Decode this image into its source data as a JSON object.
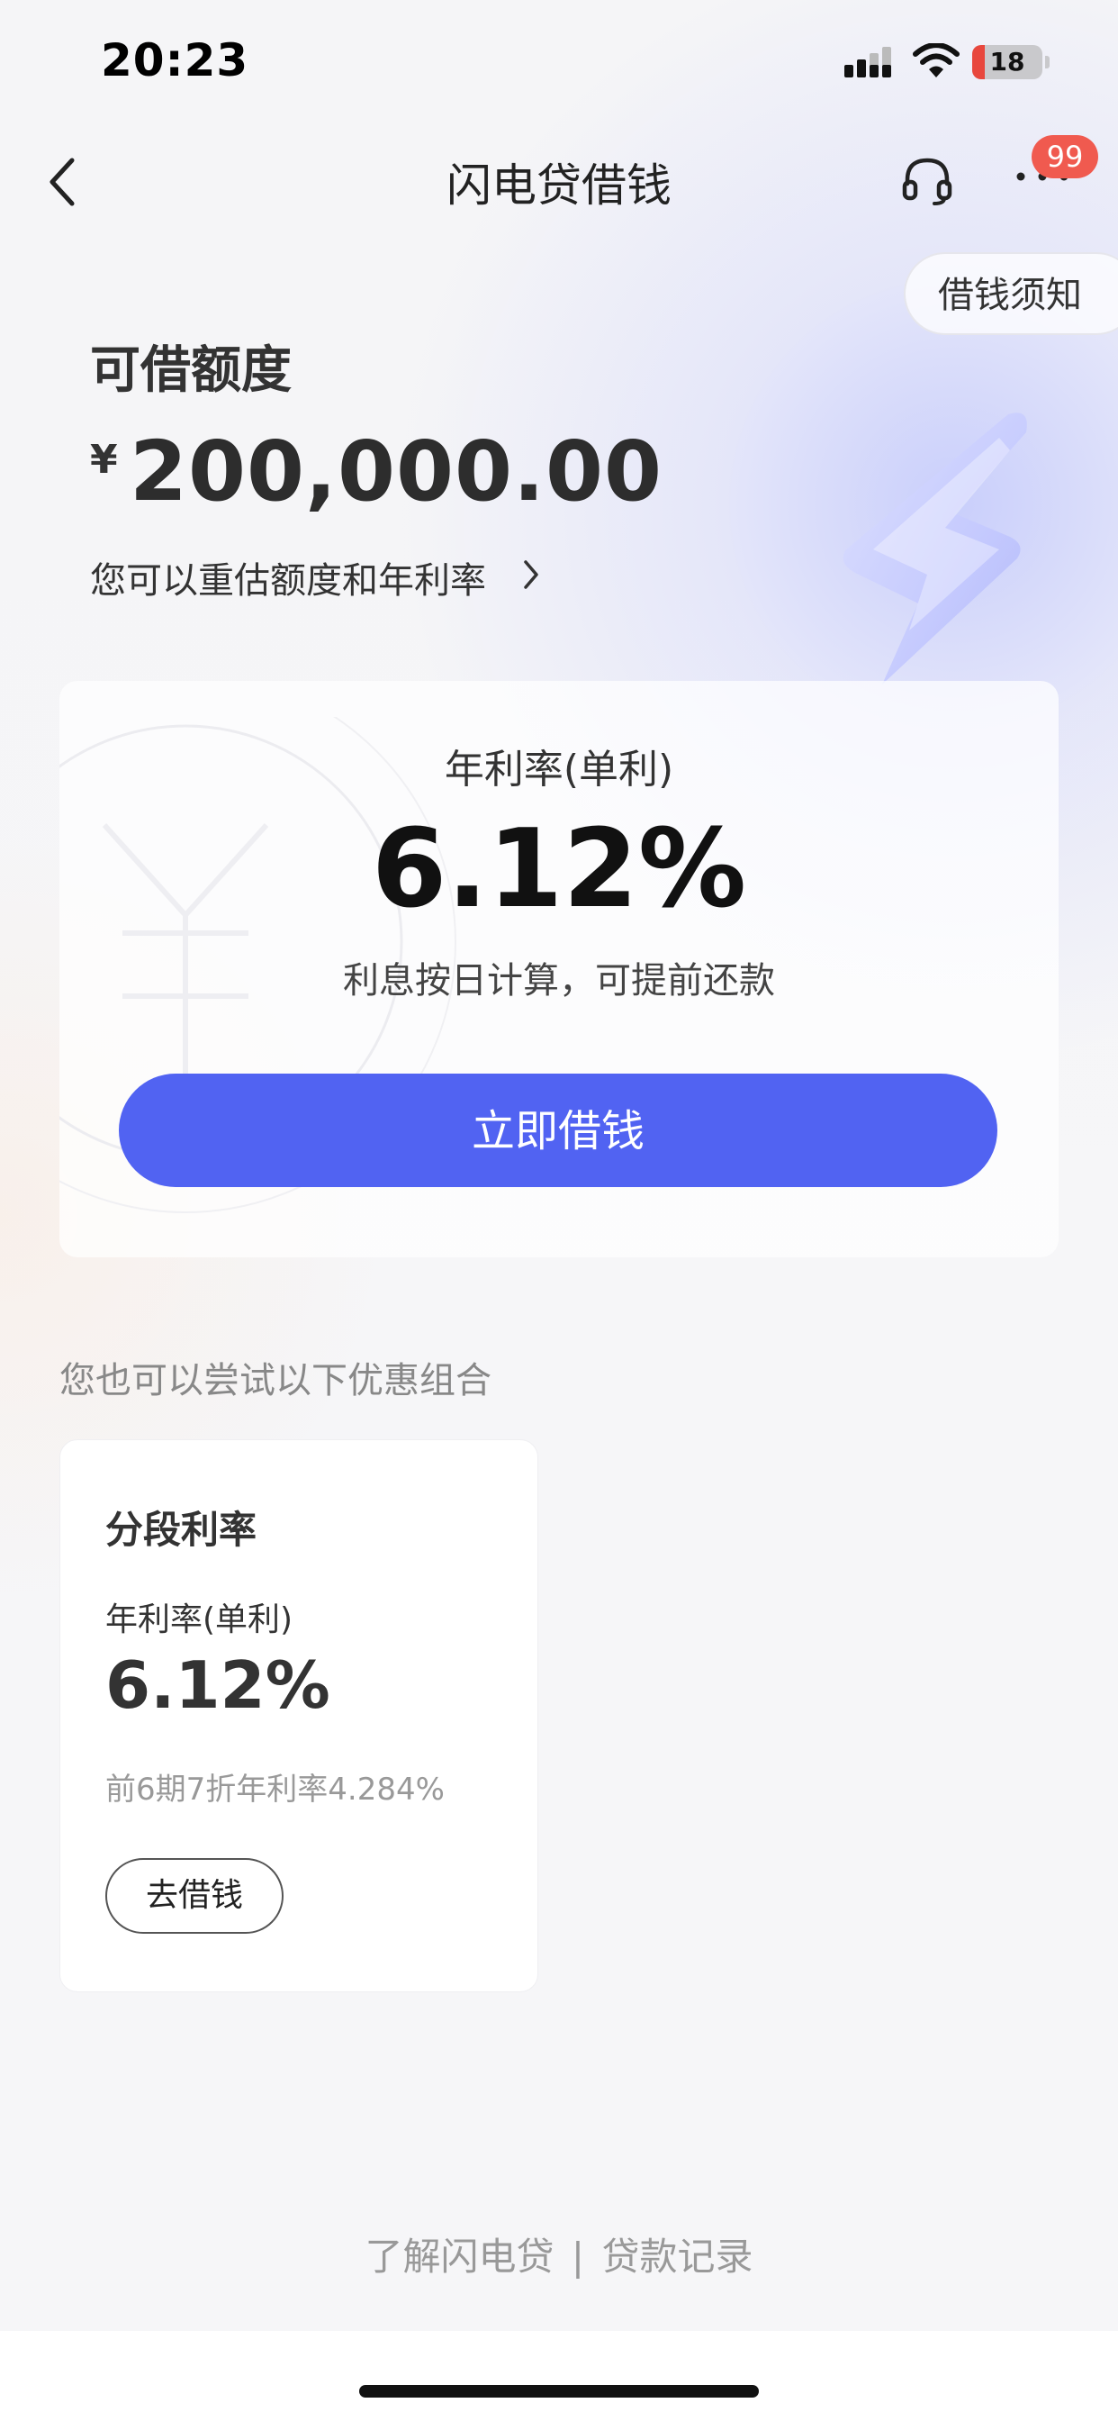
{
  "status_bar": {
    "time": "20:23",
    "battery_level": "18",
    "battery_fraction": 0.18,
    "signal_icon": "signal-icon",
    "wifi_icon": "wifi-icon"
  },
  "nav": {
    "back_icon": "chevron-left-icon",
    "title": "闪电贷借钱",
    "service_icon": "headset-icon",
    "more_icon": "more-icon",
    "badge": "99"
  },
  "notice": {
    "label": "借钱须知"
  },
  "quota": {
    "label": "可借额度",
    "currency": "¥",
    "amount": "200,000.00",
    "reestimate_text": "您可以重估额度和年利率",
    "reestimate_icon": "chevron-right-icon"
  },
  "rate_card": {
    "rate_label": "年利率(单利)",
    "rate_value": "6.12%",
    "note": "利息按日计算，可提前还款",
    "button_label": "立即借钱"
  },
  "promo": {
    "heading": "您也可以尝试以下优惠组合",
    "title": "分段利率",
    "rate_label": "年利率(单利)",
    "rate_value": "6.12%",
    "discount": "前6期7折年利率4.284%",
    "button_label": "去借钱"
  },
  "footer": {
    "link_about": "了解闪电贷",
    "separator": "|",
    "link_records": "贷款记录"
  },
  "colors": {
    "accent": "#5163f2",
    "badge": "#f05a4f",
    "battery_low": "#e8473d"
  }
}
